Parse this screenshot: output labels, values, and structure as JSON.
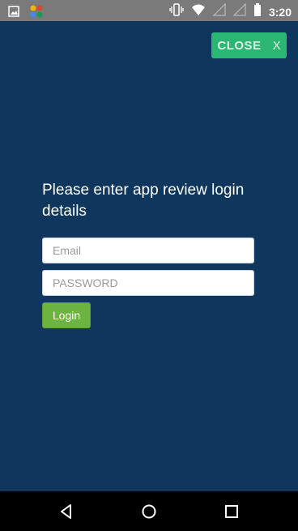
{
  "status_bar": {
    "time": "3:20",
    "icons": [
      "image-icon",
      "app-icon",
      "vibrate-icon",
      "wifi-icon",
      "signal-icon",
      "signal-icon",
      "battery-icon"
    ]
  },
  "close_button": {
    "label": "CLOSE",
    "x_glyph": "X"
  },
  "form": {
    "title": "Please enter app review login details",
    "email": {
      "placeholder": "Email",
      "value": ""
    },
    "password": {
      "placeholder": "PASSWORD",
      "value": ""
    },
    "login_label": "Login"
  },
  "nav_bar": {
    "buttons": [
      "back-icon",
      "home-icon",
      "recents-icon"
    ]
  },
  "colors": {
    "background": "#0f375e",
    "close_button": "#2bb673",
    "login_button": "#6db33f",
    "status_bar": "#7a7a7a",
    "nav_bar": "#000000"
  }
}
